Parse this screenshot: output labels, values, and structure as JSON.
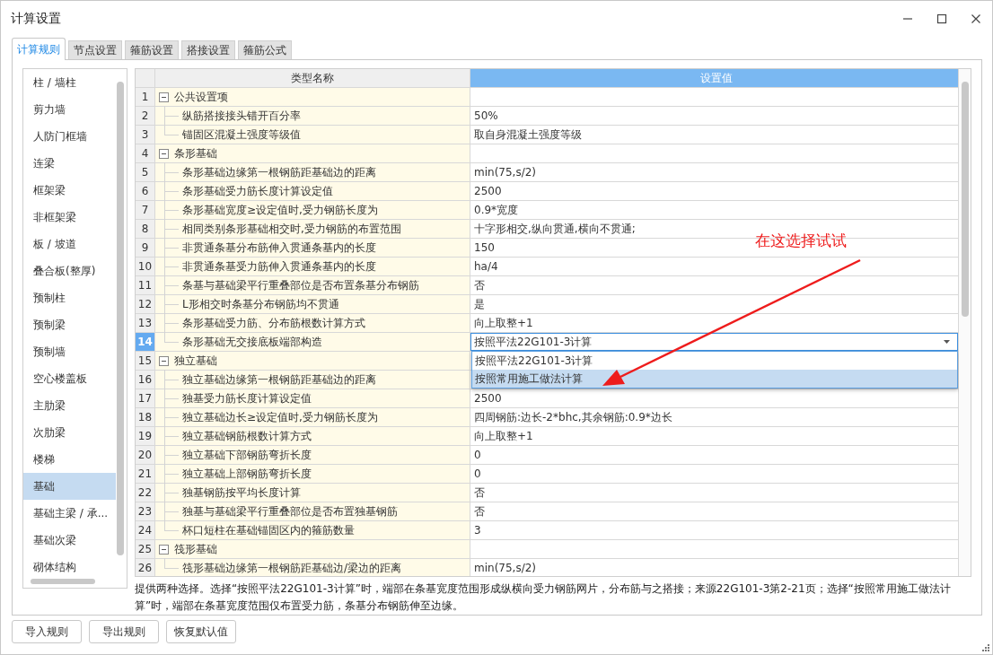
{
  "window": {
    "title": "计算设置"
  },
  "tabs": [
    {
      "label": "计算规则",
      "selected": true
    },
    {
      "label": "节点设置",
      "selected": false
    },
    {
      "label": "箍筋设置",
      "selected": false
    },
    {
      "label": "搭接设置",
      "selected": false
    },
    {
      "label": "箍筋公式",
      "selected": false
    }
  ],
  "sidebar": {
    "items": [
      {
        "label": "柱 / 墙柱",
        "selected": false
      },
      {
        "label": "剪力墙",
        "selected": false
      },
      {
        "label": "人防门框墙",
        "selected": false
      },
      {
        "label": "连梁",
        "selected": false
      },
      {
        "label": "框架梁",
        "selected": false
      },
      {
        "label": "非框架梁",
        "selected": false
      },
      {
        "label": "板 / 坡道",
        "selected": false
      },
      {
        "label": "叠合板(整厚)",
        "selected": false
      },
      {
        "label": "预制柱",
        "selected": false
      },
      {
        "label": "预制梁",
        "selected": false
      },
      {
        "label": "预制墙",
        "selected": false
      },
      {
        "label": "空心楼盖板",
        "selected": false
      },
      {
        "label": "主肋梁",
        "selected": false
      },
      {
        "label": "次肋梁",
        "selected": false
      },
      {
        "label": "楼梯",
        "selected": false
      },
      {
        "label": "基础",
        "selected": true
      },
      {
        "label": "基础主梁 / 承...",
        "selected": false
      },
      {
        "label": "基础次梁",
        "selected": false
      },
      {
        "label": "砌体结构",
        "selected": false
      }
    ]
  },
  "table": {
    "columns": [
      {
        "label": "类型名称",
        "selected": false
      },
      {
        "label": "设置值",
        "selected": true
      }
    ],
    "groups": [
      {
        "no": "1",
        "name": "公共设置项",
        "expanded": true,
        "children": [
          {
            "no": "2",
            "name": "纵筋搭接接头错开百分率",
            "value": "50%",
            "selected": false
          },
          {
            "no": "3",
            "name": "锚固区混凝土强度等级值",
            "value": "取自身混凝土强度等级",
            "selected": false
          }
        ]
      },
      {
        "no": "4",
        "name": "条形基础",
        "expanded": true,
        "children": [
          {
            "no": "5",
            "name": "条形基础边缘第一根钢筋距基础边的距离",
            "value": "min(75,s/2)",
            "selected": false
          },
          {
            "no": "6",
            "name": "条形基础受力筋长度计算设定值",
            "value": "2500",
            "selected": false
          },
          {
            "no": "7",
            "name": "条形基础宽度≥设定值时,受力钢筋长度为",
            "value": "0.9*宽度",
            "selected": false
          },
          {
            "no": "8",
            "name": "相同类别条形基础相交时,受力钢筋的布置范围",
            "value": "十字形相交,纵向贯通,横向不贯通;",
            "selected": false
          },
          {
            "no": "9",
            "name": "非贯通条基分布筋伸入贯通条基内的长度",
            "value": "150",
            "selected": false
          },
          {
            "no": "10",
            "name": "非贯通条基受力筋伸入贯通条基内的长度",
            "value": "ha/4",
            "selected": false
          },
          {
            "no": "11",
            "name": "条基与基础梁平行重叠部位是否布置条基分布钢筋",
            "value": "否",
            "selected": false
          },
          {
            "no": "12",
            "name": "L形相交时条基分布钢筋均不贯通",
            "value": "是",
            "selected": false
          },
          {
            "no": "13",
            "name": "条形基础受力筋、分布筋根数计算方式",
            "value": "向上取整+1",
            "selected": false
          },
          {
            "no": "14",
            "name": "条形基础无交接底板端部构造",
            "value": "按照平法22G101-3计算",
            "selected": true,
            "dropdown": {
              "options": [
                {
                  "label": "按照平法22G101-3计算",
                  "highlighted": false
                },
                {
                  "label": "按照常用施工做法计算",
                  "highlighted": true
                }
              ]
            }
          }
        ]
      },
      {
        "no": "15",
        "name": "独立基础",
        "expanded": true,
        "children": [
          {
            "no": "16",
            "name": "独立基础边缘第一根钢筋距基础边的距离",
            "selected": false
          },
          {
            "no": "17",
            "name": "独基受力筋长度计算设定值",
            "value": "2500",
            "selected": false
          },
          {
            "no": "18",
            "name": "独立基础边长≥设定值时,受力钢筋长度为",
            "value": "四周钢筋:边长-2*bhc,其余钢筋:0.9*边长",
            "selected": false
          },
          {
            "no": "19",
            "name": "独立基础钢筋根数计算方式",
            "value": "向上取整+1",
            "selected": false
          },
          {
            "no": "20",
            "name": "独立基础下部钢筋弯折长度",
            "value": "0",
            "selected": false
          },
          {
            "no": "21",
            "name": "独立基础上部钢筋弯折长度",
            "value": "0",
            "selected": false
          },
          {
            "no": "22",
            "name": "独基钢筋按平均长度计算",
            "value": "否",
            "selected": false
          },
          {
            "no": "23",
            "name": "独基与基础梁平行重叠部位是否布置独基钢筋",
            "value": "否",
            "selected": false
          },
          {
            "no": "24",
            "name": "杯口短柱在基础锚固区内的箍筋数量",
            "value": "3",
            "selected": false
          }
        ]
      },
      {
        "no": "25",
        "name": "筏形基础",
        "expanded": true,
        "children": [
          {
            "no": "26",
            "name": "筏形基础边缘第一根钢筋距基础边/梁边的距离",
            "value": "min(75,s/2)",
            "selected": false
          }
        ]
      }
    ]
  },
  "description": "提供两种选择。选择“按照平法22G101-3计算”时，端部在条基宽度范围形成纵横向受力钢筋网片，分布筋与之搭接；来源22G101-3第2-21页；选择“按照常用施工做法计算”时，端部在条基宽度范围仅布置受力筋，条基分布钢筋伸至边缘。",
  "annotation": {
    "text": "在这选择试试"
  },
  "buttons": [
    "导入规则",
    "导出规则",
    "恢复默认值"
  ]
}
